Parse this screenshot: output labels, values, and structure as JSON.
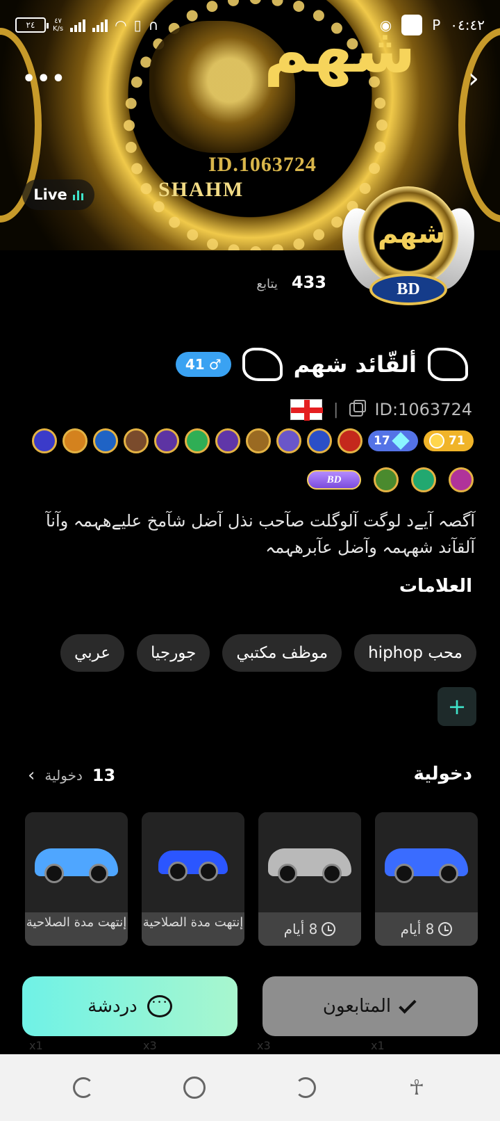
{
  "status_bar": {
    "time": "٠٤:٤٢",
    "battery": "٢٤",
    "speed_value": "٤٧",
    "speed_unit": "K/s"
  },
  "banner": {
    "emblem_id": "ID.1063724",
    "emblem_name": "SHAHM",
    "emblem_arabic": "شهم",
    "live_label": "Live"
  },
  "avatar": {
    "plate": "BD",
    "arabic": "شهم"
  },
  "profile": {
    "following_count": "433",
    "following_label": "يتابع",
    "name": "ألقّائد شهم",
    "gender_symbol": "♂",
    "age": "41",
    "id_text": "ID:1063724",
    "separator": "|",
    "level_gold": "71",
    "level_blue": "17",
    "bd_badge": "BD",
    "bio": "آگصہ آيےد لوگت آلوگلت صآحب نذل آضل شآمخ عليےهہمہ وآنآ آلقآند شهہمہ وآضل عآبرهہمہ"
  },
  "tags_section": {
    "title": "العلامات",
    "tags": [
      "محب hiphop",
      "موظف مكتبي",
      "جورجيا",
      "عربي"
    ],
    "add_label": "+"
  },
  "entries_section": {
    "title": "دخولية",
    "count": "13",
    "count_label": "دخولية",
    "cards": [
      {
        "status": "8 أيام",
        "expired": false,
        "color": "#3a6cff"
      },
      {
        "status": "8 أيام",
        "expired": false,
        "color": "#b9b9b9"
      },
      {
        "status": "إنتهت مدة الصلاحية",
        "expired": true,
        "color": "#2b56ff"
      },
      {
        "status": "إنتهت مدة الصلاحية",
        "expired": true,
        "color": "#4fa6ff"
      }
    ],
    "ghost_counts": [
      "x1",
      "x3",
      "x3",
      "x1"
    ]
  },
  "actions": {
    "followers_label": "المتابعون",
    "chat_label": "دردشة"
  },
  "colors": {
    "accent": "#3fe3c9",
    "age_badge": "#3aa2f2",
    "gold": "#f0b429"
  }
}
